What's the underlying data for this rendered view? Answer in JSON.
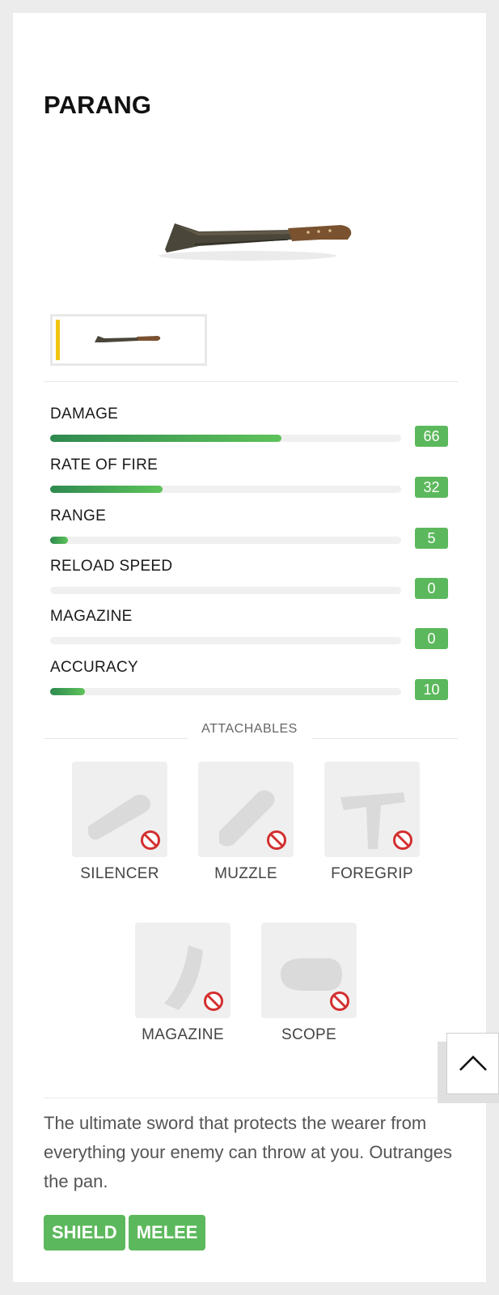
{
  "weapon": {
    "name": "PARANG"
  },
  "stats": [
    {
      "label": "DAMAGE",
      "value": "66",
      "percent": 66
    },
    {
      "label": "RATE OF FIRE",
      "value": "32",
      "percent": 32
    },
    {
      "label": "RANGE",
      "value": "5",
      "percent": 5
    },
    {
      "label": "RELOAD SPEED",
      "value": "0",
      "percent": 0
    },
    {
      "label": "MAGAZINE",
      "value": "0",
      "percent": 0
    },
    {
      "label": "ACCURACY",
      "value": "10",
      "percent": 10
    }
  ],
  "attachables": {
    "title": "ATTACHABLES",
    "items": [
      {
        "label": "SILENCER",
        "icon": "silencer-icon",
        "available": false
      },
      {
        "label": "MUZZLE",
        "icon": "muzzle-icon",
        "available": false
      },
      {
        "label": "FOREGRIP",
        "icon": "foregrip-icon",
        "available": false
      },
      {
        "label": "MAGAZINE",
        "icon": "magazine-icon",
        "available": false
      },
      {
        "label": "SCOPE",
        "icon": "scope-icon",
        "available": false
      }
    ]
  },
  "description": "The ultimate sword that protects the wearer from everything your enemy can throw at you. Outranges the pan.",
  "tags": [
    "SHIELD",
    "MELEE"
  ],
  "colors": {
    "accent": "#5cb85c",
    "selected_marker": "#f1c40f",
    "unavailable": "#d32f2f"
  }
}
